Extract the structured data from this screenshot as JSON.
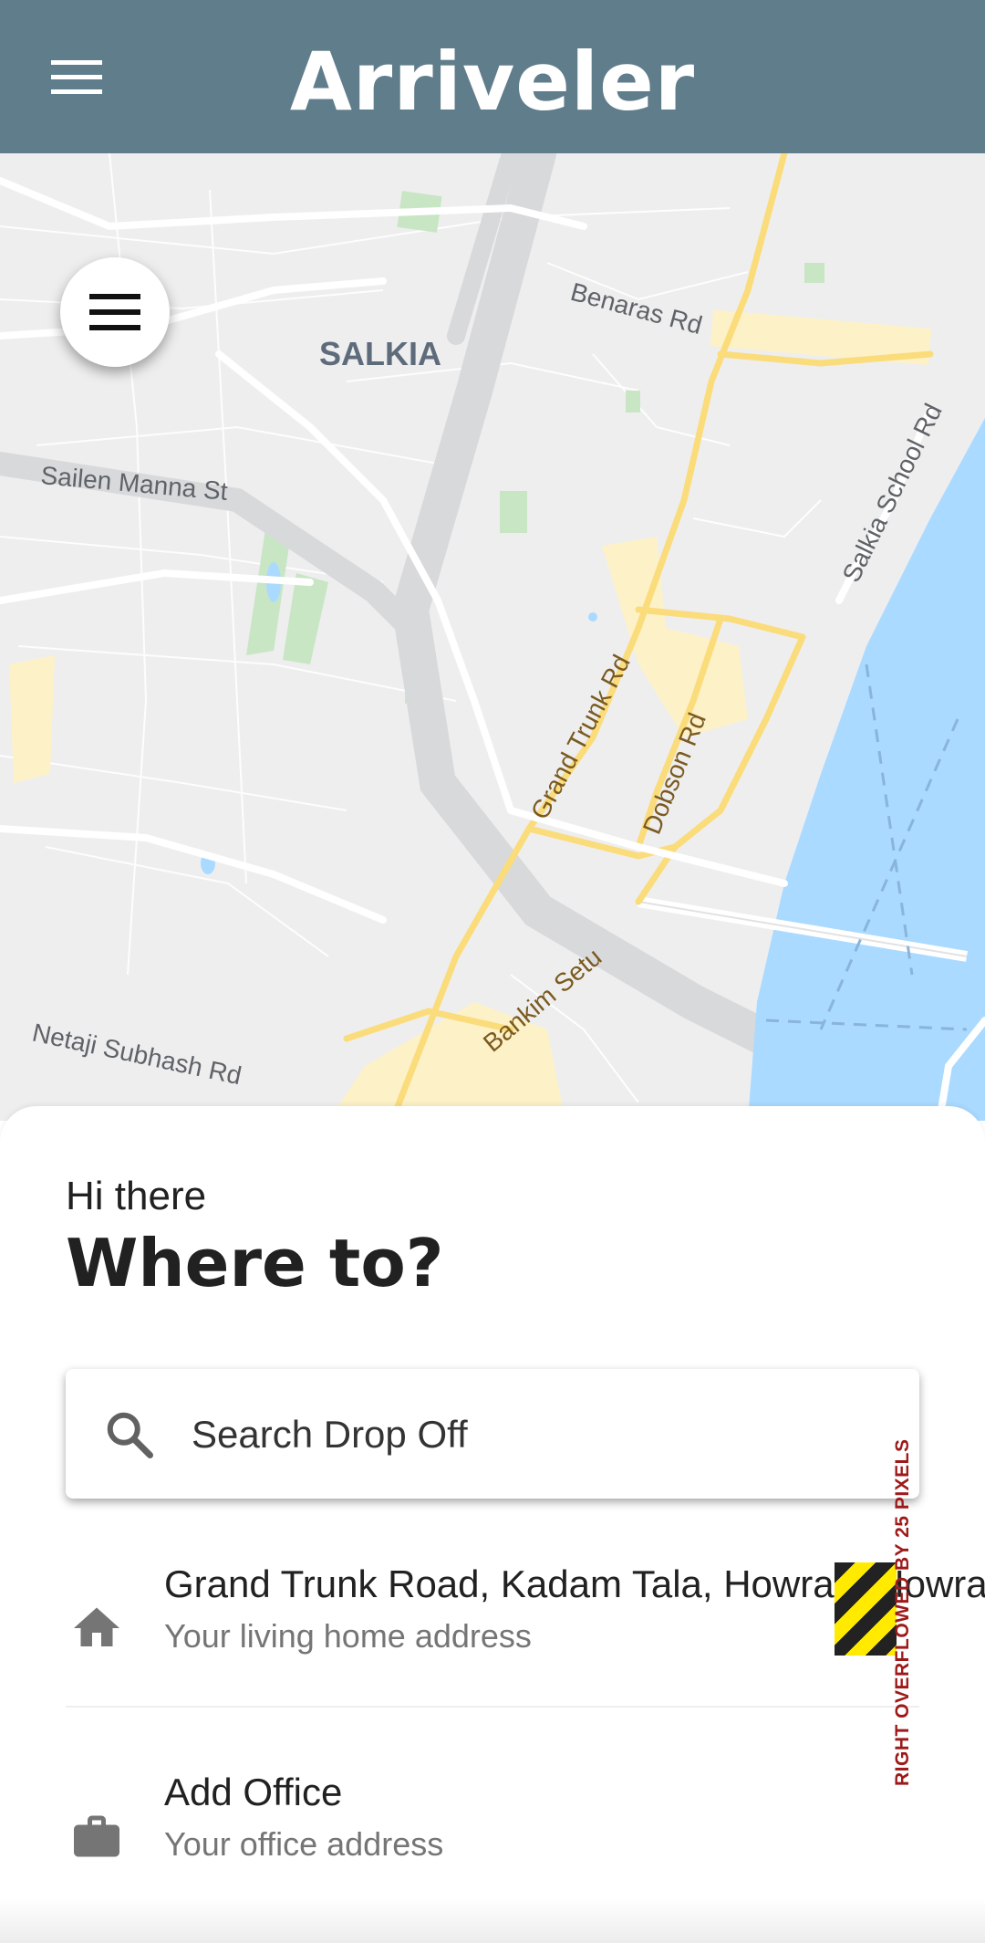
{
  "app_bar": {
    "title": "Arriveler"
  },
  "map": {
    "labels": {
      "salkia": "SALKIA",
      "benaras": "Benaras Rd",
      "sailen": "Sailen Manna St",
      "salkia_school": "Salkia School Rd",
      "grand_trunk": "Grand Trunk Rd",
      "dobson": "Dobson Rd",
      "bankim": "Bankim Setu",
      "netaji": "Netaji Subhash Rd"
    }
  },
  "sheet": {
    "greeting": "Hi there",
    "heading": "Where to?",
    "search": {
      "placeholder": "Search Drop Off"
    },
    "places": [
      {
        "title": "Grand Trunk Road, Kadam Tala, Howrah, Howrah",
        "subtitle": "Your living home address",
        "icon": "home-icon"
      },
      {
        "title": "Add Office",
        "subtitle": "Your office address",
        "icon": "work-icon"
      }
    ],
    "overflow_warning": "RIGHT OVERFLOWED BY 25 PIXELS"
  },
  "colors": {
    "app_bar": "#607d8b",
    "map_bg": "#eeeeef",
    "water": "#aadaff",
    "main_road": "#fbdc7b",
    "park": "#c8e6c4"
  }
}
